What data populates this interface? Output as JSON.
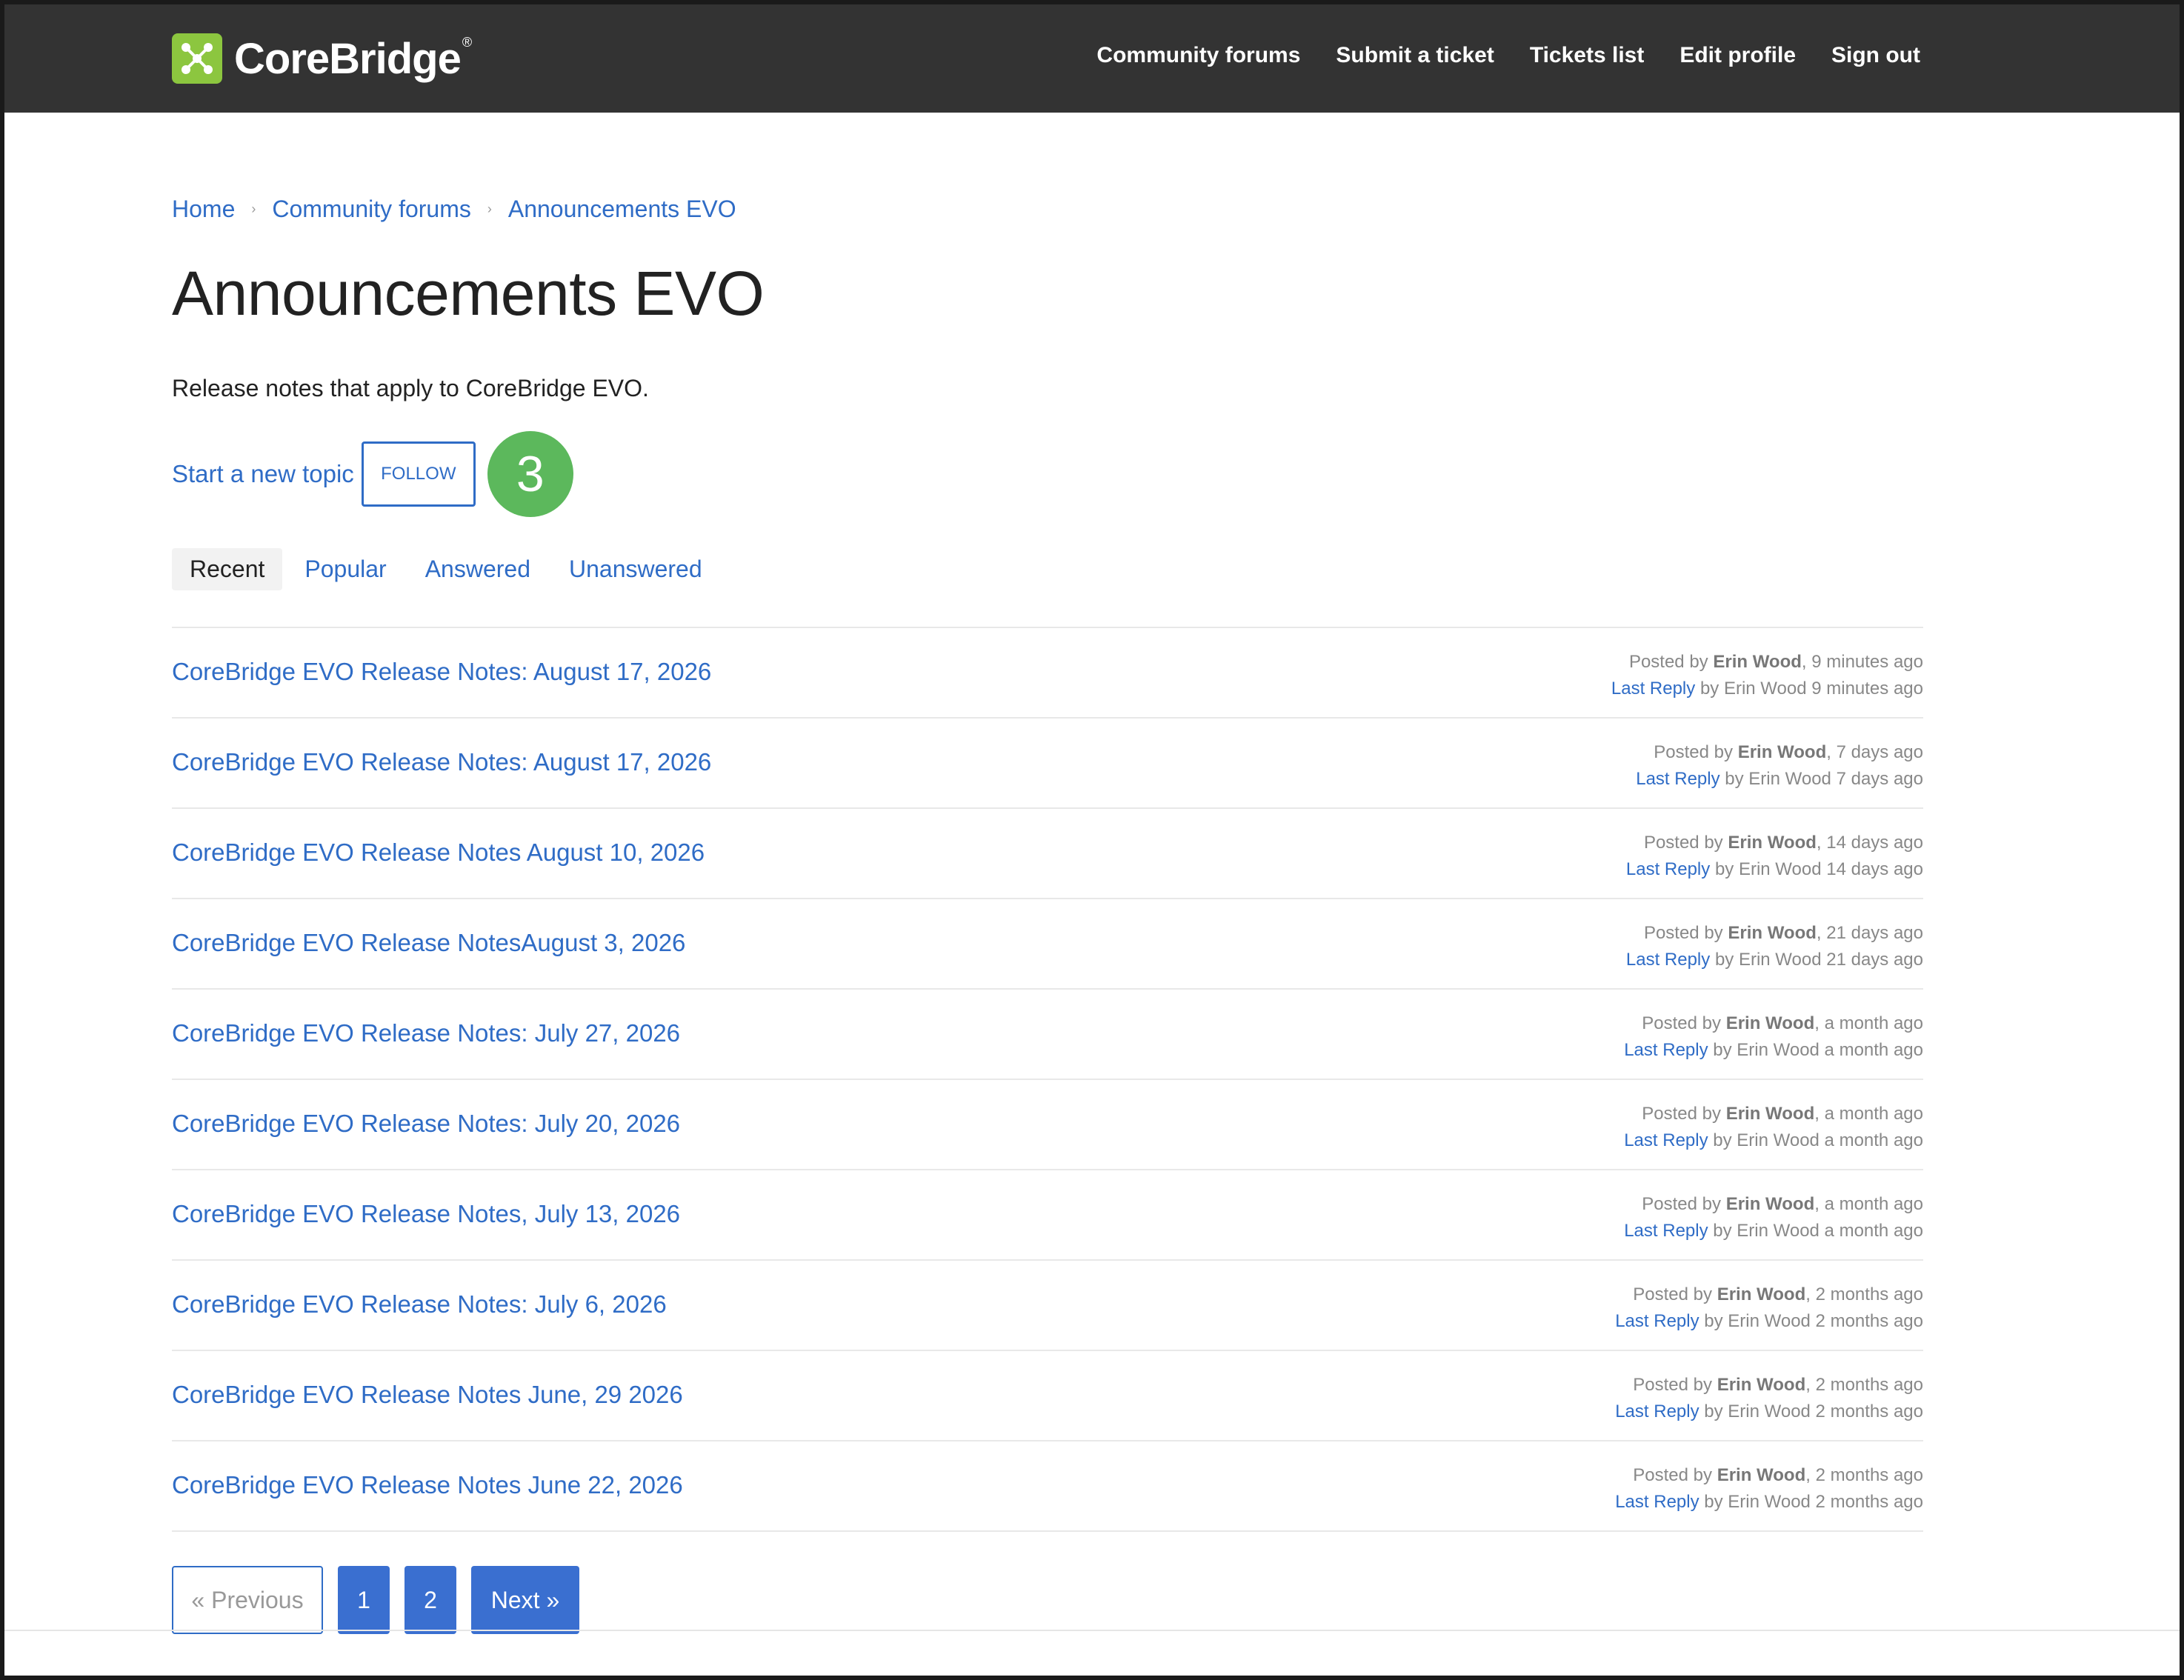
{
  "brand": {
    "name": "CoreBridge",
    "reg": "®",
    "color": "#8cc63f"
  },
  "nav": {
    "items": [
      "Community forums",
      "Submit a ticket",
      "Tickets list",
      "Edit profile",
      "Sign out"
    ]
  },
  "breadcrumb": [
    "Home",
    "Community forums",
    "Announcements EVO"
  ],
  "page": {
    "title": "Announcements EVO",
    "description": "Release notes that apply to CoreBridge EVO.",
    "new_topic_label": "Start a new topic",
    "follow_label": "FOLLOW",
    "step_badge": "3"
  },
  "tabs": [
    "Recent",
    "Popular",
    "Answered",
    "Unanswered"
  ],
  "topics": [
    {
      "title": "CoreBridge EVO Release Notes: August 17, 2026",
      "posted_prefix": "Posted by",
      "author": "Erin Wood",
      "posted_when": ", 9 minutes ago",
      "last_reply_label": "Last Reply",
      "reply_by": "by Erin Wood 9 minutes ago"
    },
    {
      "title": "CoreBridge EVO Release Notes: August 17, 2026",
      "posted_prefix": "Posted by",
      "author": "Erin Wood",
      "posted_when": ", 7 days ago",
      "last_reply_label": "Last Reply",
      "reply_by": "by Erin Wood 7 days ago"
    },
    {
      "title": "CoreBridge EVO Release Notes August 10, 2026",
      "posted_prefix": "Posted by",
      "author": "Erin Wood",
      "posted_when": ", 14 days ago",
      "last_reply_label": "Last Reply",
      "reply_by": "by Erin Wood 14 days ago"
    },
    {
      "title": "CoreBridge EVO Release NotesAugust 3, 2026",
      "posted_prefix": "Posted by",
      "author": "Erin Wood",
      "posted_when": ", 21 days ago",
      "last_reply_label": "Last Reply",
      "reply_by": "by Erin Wood 21 days ago"
    },
    {
      "title": "CoreBridge EVO Release Notes: July 27, 2026",
      "posted_prefix": "Posted by",
      "author": "Erin Wood",
      "posted_when": ", a month ago",
      "last_reply_label": "Last Reply",
      "reply_by": "by Erin Wood a month ago"
    },
    {
      "title": "CoreBridge EVO Release Notes: July 20, 2026",
      "posted_prefix": "Posted by",
      "author": "Erin Wood",
      "posted_when": ", a month ago",
      "last_reply_label": "Last Reply",
      "reply_by": "by Erin Wood a month ago"
    },
    {
      "title": "CoreBridge EVO Release Notes, July 13, 2026",
      "posted_prefix": "Posted by",
      "author": "Erin Wood",
      "posted_when": ", a month ago",
      "last_reply_label": "Last Reply",
      "reply_by": "by Erin Wood a month ago"
    },
    {
      "title": "CoreBridge EVO Release Notes: July 6, 2026",
      "posted_prefix": "Posted by",
      "author": "Erin Wood",
      "posted_when": ", 2 months ago",
      "last_reply_label": "Last Reply",
      "reply_by": "by Erin Wood 2 months ago"
    },
    {
      "title": "CoreBridge EVO Release Notes June, 29 2026",
      "posted_prefix": "Posted by",
      "author": "Erin Wood",
      "posted_when": ", 2 months ago",
      "last_reply_label": "Last Reply",
      "reply_by": "by Erin Wood 2 months ago"
    },
    {
      "title": "CoreBridge EVO Release Notes June 22, 2026",
      "posted_prefix": "Posted by",
      "author": "Erin Wood",
      "posted_when": ", 2 months ago",
      "last_reply_label": "Last Reply",
      "reply_by": "by Erin Wood 2 months ago"
    }
  ],
  "pagination": {
    "previous": "« Previous",
    "pages": [
      "1",
      "2"
    ],
    "next": "Next »"
  },
  "colors": {
    "header_bg": "#333333",
    "link": "#2f6cc6",
    "badge": "#5cb85c",
    "page_button": "#3a6fd0"
  }
}
